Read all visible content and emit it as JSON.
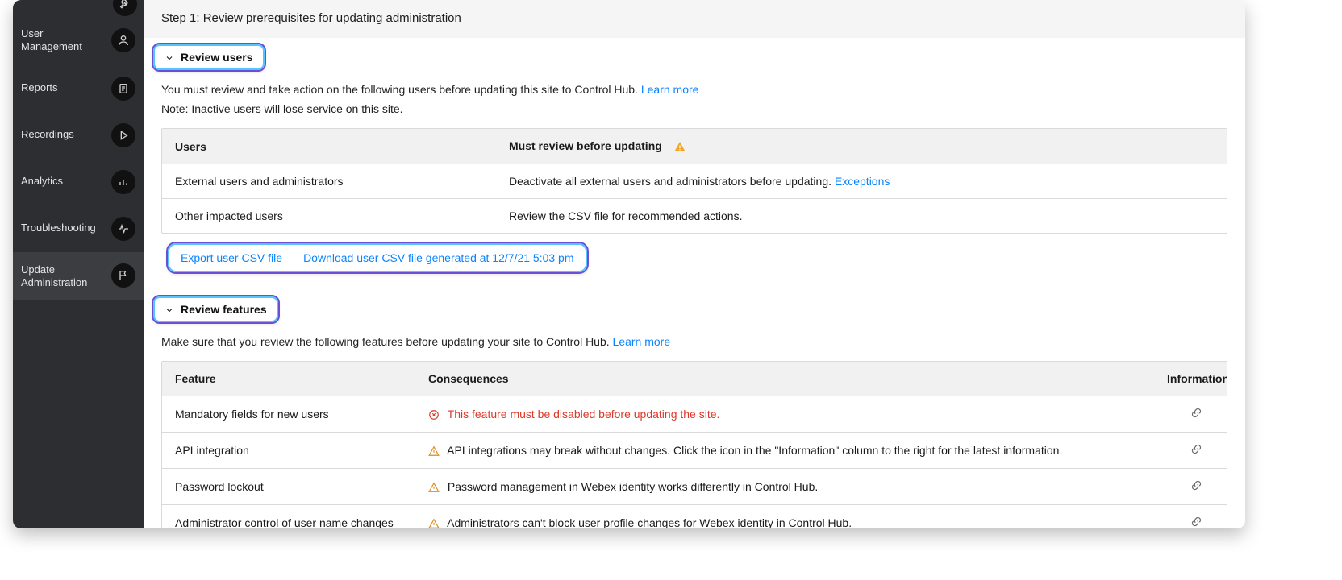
{
  "sidebar": {
    "items": [
      {
        "label": "",
        "icon": "wrench-icon"
      },
      {
        "label": "User Management",
        "icon": "user-icon"
      },
      {
        "label": "Reports",
        "icon": "document-icon"
      },
      {
        "label": "Recordings",
        "icon": "play-icon"
      },
      {
        "label": "Analytics",
        "icon": "bar-chart-icon"
      },
      {
        "label": "Troubleshooting",
        "icon": "activity-icon"
      },
      {
        "label": "Update\nAdministration",
        "icon": "flag-icon",
        "active": true
      }
    ]
  },
  "main": {
    "step_title": "Step 1: Review prerequisites for updating administration"
  },
  "review_users": {
    "header": "Review users",
    "intro_text": "You must review and take action on the following users before updating this site to Control Hub. ",
    "intro_link": "Learn more",
    "note": "Note: Inactive users will lose service on this site.",
    "table": {
      "col1": "Users",
      "col2": "Must review before updating",
      "rows": [
        {
          "users": "External users and administrators",
          "action_text": "Deactivate all external users and administrators before updating. ",
          "action_link": "Exceptions"
        },
        {
          "users": "Other impacted users",
          "action_text": "Review the CSV file for recommended actions.",
          "action_link": ""
        }
      ]
    },
    "csv": {
      "export": "Export user CSV file",
      "download": "Download user CSV file generated at 12/7/21 5:03 pm"
    }
  },
  "review_features": {
    "header": "Review features",
    "intro_text": "Make sure that you review the following features before updating your site to Control Hub. ",
    "intro_link": "Learn more",
    "table": {
      "col1": "Feature",
      "col2": "Consequences",
      "col3": "Information",
      "rows": [
        {
          "feature": "Mandatory fields for new users",
          "severity": "error",
          "consequence": "This feature must be disabled before updating the site."
        },
        {
          "feature": "API integration",
          "severity": "warn",
          "consequence": "API integrations may break without changes. Click the icon in the \"Information\"  column to the right for the latest information."
        },
        {
          "feature": "Password lockout",
          "severity": "warn",
          "consequence": "Password management in Webex identity works differently in Control Hub."
        },
        {
          "feature": "Administrator control of user name changes",
          "severity": "warn",
          "consequence": "Administrators can't block user profile changes for Webex identity in Control Hub."
        }
      ]
    }
  }
}
